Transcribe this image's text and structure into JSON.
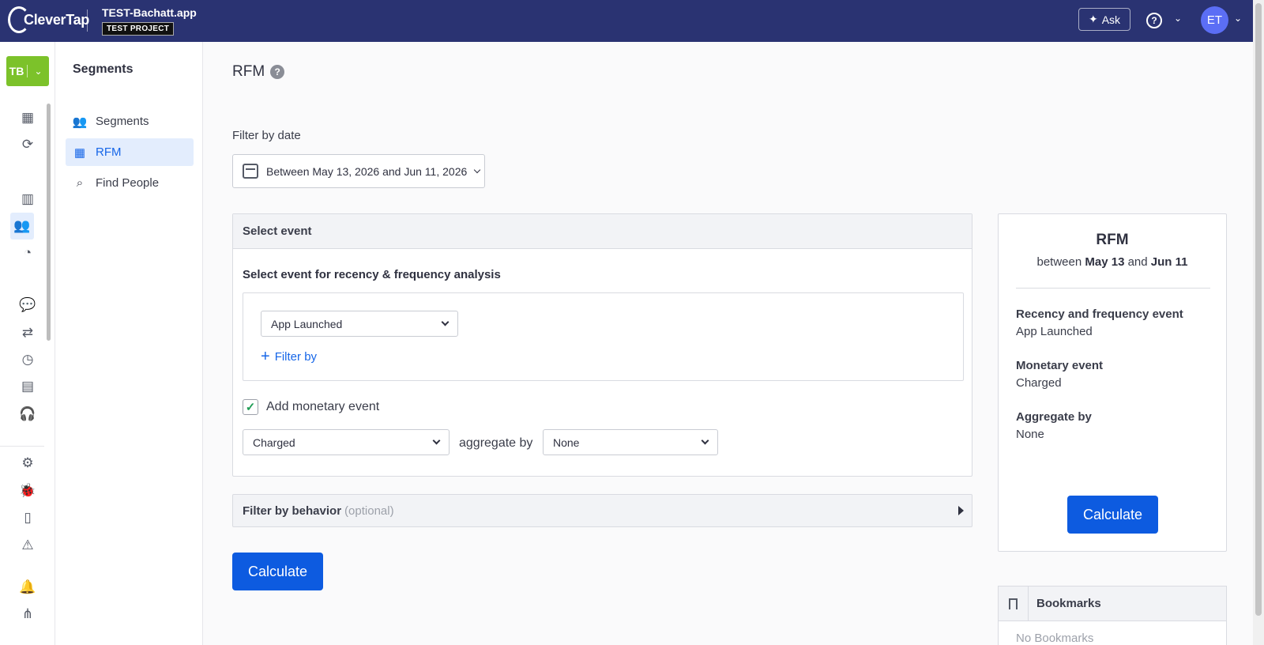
{
  "topbar": {
    "brand": "CleverTap",
    "app_name": "TEST-Bachatt.app",
    "badge": "TEST PROJECT",
    "ask_label": "Ask",
    "help_symbol": "?",
    "avatar_initials": "ET"
  },
  "rail": {
    "project_initials": "TB",
    "icons": [
      "dashboard-icon",
      "analytics-icon",
      "bar-chart-icon",
      "segments-icon",
      "insights-icon",
      "messages-icon",
      "journeys-icon",
      "schedule-icon",
      "catalog-icon",
      "support-icon",
      "settings-icon",
      "debug-icon",
      "docs-icon",
      "alert-icon",
      "notifications-icon",
      "sitemap-icon"
    ]
  },
  "subnav": {
    "title": "Segments",
    "items": [
      {
        "label": "Segments",
        "icon": "users-icon"
      },
      {
        "label": "RFM",
        "icon": "grid-icon"
      },
      {
        "label": "Find People",
        "icon": "find-people-icon"
      }
    ]
  },
  "main": {
    "title": "RFM",
    "help_symbol": "?",
    "filter_label": "Filter by date",
    "date_range": "Between May 13, 2026 and Jun 11, 2026",
    "select_event": {
      "header": "Select event",
      "subheading": "Select event for recency & frequency analysis",
      "event_value": "App Launched",
      "filter_by": "Filter by",
      "monetary_checkbox_label": "Add monetary event",
      "monetary_checked": true,
      "monetary_value": "Charged",
      "aggregate_label": "aggregate by",
      "aggregate_value": "None"
    },
    "behavior": {
      "label": "Filter by behavior",
      "optional": "(optional)"
    },
    "calculate_label": "Calculate"
  },
  "summary": {
    "title": "RFM",
    "range_prefix": "between",
    "range_start": "May 13",
    "range_and": "and",
    "range_end": "Jun 11",
    "recency_key": "Recency and frequency event",
    "recency_value": "App Launched",
    "monetary_key": "Monetary event",
    "monetary_value": "Charged",
    "aggregate_key": "Aggregate by",
    "aggregate_value": "None",
    "calculate_label": "Calculate"
  },
  "bookmarks": {
    "title": "Bookmarks",
    "empty": "No Bookmarks"
  },
  "colors": {
    "topbar": "#2a3372",
    "primary": "#0d5be0",
    "active_bg": "#e3edfd",
    "project_green": "#7cc22a",
    "avatar": "#5b6ef5"
  }
}
